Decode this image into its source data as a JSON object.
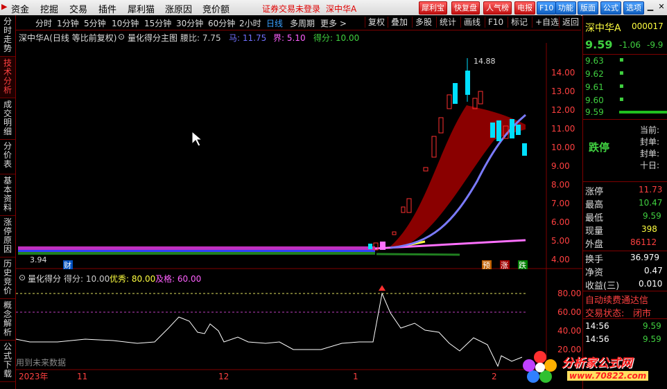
{
  "menu": {
    "items": [
      "资金",
      "挖掘",
      "交易",
      "插件",
      "犀利猫",
      "涨原因",
      "竞价额"
    ],
    "warning": "证券交易未登录",
    "stock_name": "深中华A",
    "red_buttons": [
      "犀利宝",
      "快复盘",
      "人气榜",
      "电报"
    ],
    "blue_buttons": [
      "F10",
      "功能",
      "版面",
      "公式",
      "选项"
    ]
  },
  "left_tabs": [
    "分时走势",
    "技术分析",
    "成交明细",
    "分价表",
    "基本资料",
    "涨停原因",
    "历史竞价",
    "概念解析",
    "公式下载"
  ],
  "period_bar": {
    "periods": [
      "分时",
      "1分钟",
      "5分钟",
      "10分钟",
      "15分钟",
      "30分钟",
      "60分钟",
      "2小时",
      "日线",
      "多周期",
      "更多 >"
    ],
    "selected": "日线",
    "tools": [
      "复权",
      "叠加",
      "多股",
      "统计",
      "画线",
      "F10",
      "标记",
      "+自选",
      "返回"
    ]
  },
  "main_chart": {
    "title": "深中华A(日线 等比前复权)",
    "indicator_name": "量化得分主图",
    "params": [
      {
        "label": "腰比: 7.75",
        "color": "#cccccc"
      },
      {
        "label": "马: 11.75",
        "color": "#7070ff"
      },
      {
        "label": "界: 5.10",
        "color": "#ff60ff"
      },
      {
        "label": "得分: 10.00",
        "color": "#40d040"
      }
    ],
    "y_ticks": [
      "14.00",
      "13.00",
      "12.00",
      "11.00",
      "10.00",
      "9.00",
      "8.00",
      "7.00",
      "6.00",
      "5.00",
      "4.00"
    ],
    "high_label": "14.88",
    "low_label": "3.94",
    "badges": [
      {
        "text": "财",
        "bg": "#0050c0",
        "fg": "#ffffff"
      },
      {
        "text": "预",
        "bg": "#c06000",
        "fg": "#ffffff"
      },
      {
        "text": "涨",
        "bg": "#a00000",
        "fg": "#ffffff"
      },
      {
        "text": "跌",
        "bg": "#008000",
        "fg": "#ffffff"
      }
    ]
  },
  "sub_chart": {
    "title": "量化得分",
    "params": [
      {
        "label": "得分: 10.00",
        "color": "#cccccc"
      },
      {
        "label": "优秀: 80.00",
        "color": "#ffff40"
      },
      {
        "label": "及格: 60.00",
        "color": "#ff60ff"
      }
    ],
    "y_ticks": [
      "80.00",
      "60.00",
      "40.00",
      "20.00"
    ],
    "watermark": "用到未来数据"
  },
  "time_axis": [
    "2023年",
    "11",
    "12",
    "1",
    "2"
  ],
  "right_panel": {
    "name": "深中华A",
    "code": "000017",
    "price": "9.59",
    "change": "-1.06",
    "change_pct": "-9.9",
    "bids": [
      {
        "price": "9.63",
        "mark": "▪"
      },
      {
        "price": "9.62",
        "mark": "▪"
      },
      {
        "price": "9.61",
        "mark": "▪"
      },
      {
        "price": "9.60",
        "mark": "▪"
      },
      {
        "price": "9.59",
        "mark": ""
      }
    ],
    "status": "跌停",
    "status_lines": [
      "当前:",
      "封单:",
      "封单:",
      "十日:"
    ],
    "stats": [
      {
        "label": "涨停",
        "value": "11.73",
        "color": "#ff4040"
      },
      {
        "label": "最高",
        "value": "10.47",
        "color": "#40d040"
      },
      {
        "label": "最低",
        "value": "9.59",
        "color": "#40d040"
      },
      {
        "label": "现量",
        "value": "398",
        "color": "#ffff40"
      },
      {
        "label": "外盘",
        "value": "86112",
        "color": "#ff4040"
      },
      {
        "label": "换手",
        "value": "36.979",
        "color": "#ffffff"
      },
      {
        "label": "净资",
        "value": "0.47",
        "color": "#ffffff"
      },
      {
        "label": "收益(三)",
        "value": "0.010",
        "color": "#ffffff"
      }
    ],
    "promo": "自动续费通达信",
    "trade_state_label": "交易状态:",
    "trade_state_value": "闭市",
    "ticks": [
      {
        "time": "14:56",
        "price": "9.59"
      },
      {
        "time": "14:56",
        "price": "9.59"
      }
    ]
  },
  "watermark_logo": {
    "text": "分析家公式网",
    "url": "www.70822.com"
  },
  "colors": {
    "up": "#ff3030",
    "down": "#00e0ff",
    "frame": "#800000"
  }
}
